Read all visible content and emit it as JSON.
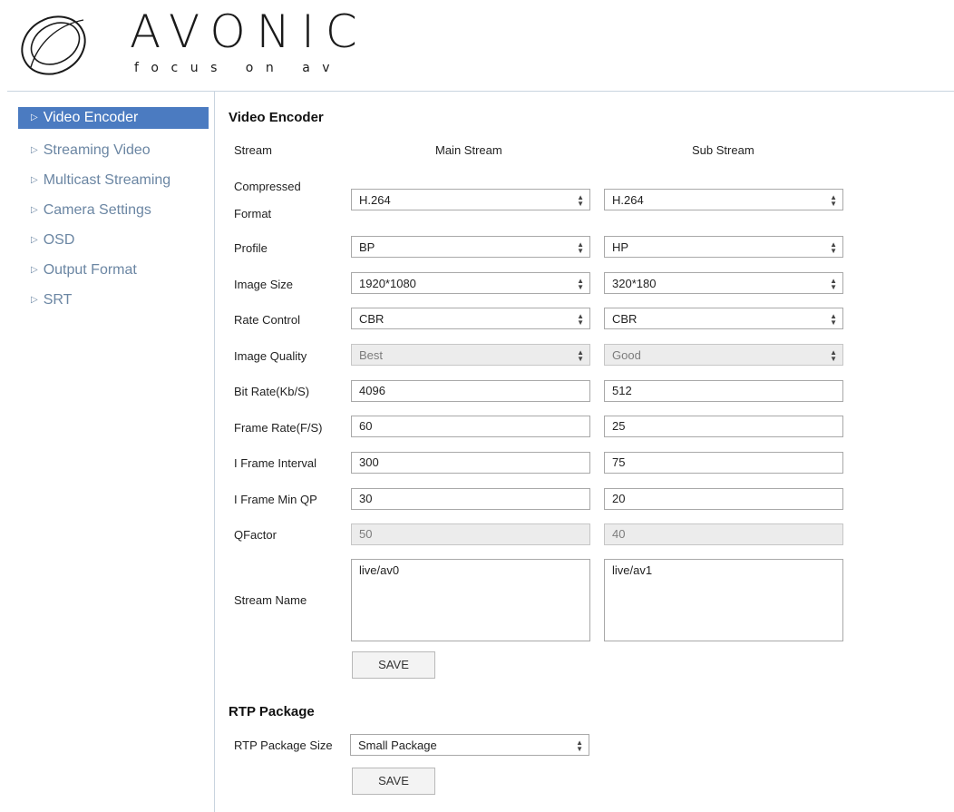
{
  "brand": {
    "name": "AVONIC",
    "tagline": "focus on av"
  },
  "sidebar": {
    "items": [
      {
        "label": "Video Encoder",
        "active": true
      },
      {
        "label": "Streaming Video"
      },
      {
        "label": "Multicast Streaming"
      },
      {
        "label": "Camera Settings"
      },
      {
        "label": "OSD"
      },
      {
        "label": "Output Format"
      },
      {
        "label": "SRT"
      }
    ]
  },
  "video_encoder": {
    "title": "Video Encoder",
    "stream_label": "Stream",
    "main_header": "Main Stream",
    "sub_header": "Sub Stream",
    "compressed_format": {
      "label_line1": "Compressed",
      "label_line2": "Format",
      "main": "H.264",
      "sub": "H.264"
    },
    "profile": {
      "label": "Profile",
      "main": "BP",
      "sub": "HP"
    },
    "image_size": {
      "label": "Image Size",
      "main": "1920*1080",
      "sub": "320*180"
    },
    "rate_control": {
      "label": "Rate Control",
      "main": "CBR",
      "sub": "CBR"
    },
    "image_quality": {
      "label": "Image Quality",
      "main": "Best",
      "sub": "Good"
    },
    "bit_rate": {
      "label": "Bit Rate(Kb/S)",
      "main": "4096",
      "sub": "512"
    },
    "frame_rate": {
      "label": "Frame Rate(F/S)",
      "main": "60",
      "sub": "25"
    },
    "i_frame_interval": {
      "label": "I Frame Interval",
      "main": "300",
      "sub": "75"
    },
    "i_frame_min_qp": {
      "label": "I Frame Min QP",
      "main": "30",
      "sub": "20"
    },
    "qfactor": {
      "label": "QFactor",
      "main": "50",
      "sub": "40"
    },
    "stream_name": {
      "label": "Stream Name",
      "main": "live/av0",
      "sub": "live/av1"
    },
    "save_label": "SAVE"
  },
  "rtp_package": {
    "title": "RTP Package",
    "size_label": "RTP Package Size",
    "size_value": "Small Package",
    "save_label": "SAVE"
  },
  "colors": {
    "accent": "#4b7bc1",
    "sidebar_text": "#6b86a3",
    "divider": "#c9d4df"
  }
}
